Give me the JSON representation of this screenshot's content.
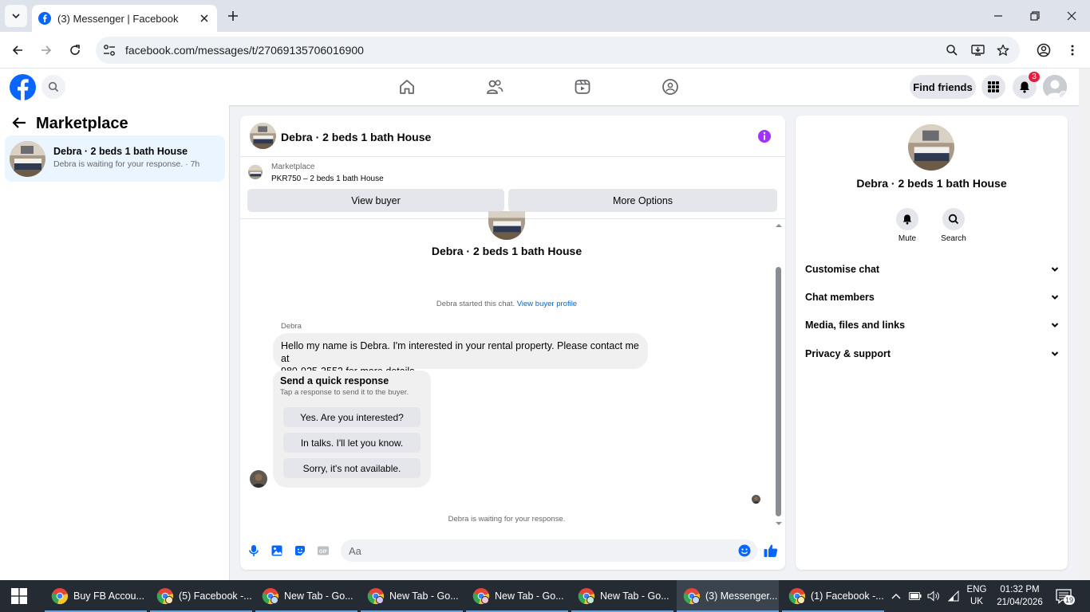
{
  "browser": {
    "tab_title": "(3) Messenger | Facebook",
    "url": "facebook.com/messages/t/27069135706016900"
  },
  "fb_header": {
    "find_friends_label": "Find friends",
    "notification_count": "3"
  },
  "left_panel": {
    "title": "Marketplace",
    "conversations": [
      {
        "name": "Debra · 2 beds 1 bath House",
        "preview": "Debra is waiting for your response. · 7h"
      }
    ]
  },
  "chat": {
    "header_name": "Debra · 2 beds 1 bath House",
    "marketplace_label": "Marketplace",
    "listing": "PKR750 – 2 beds 1 bath House",
    "view_buyer_label": "View buyer",
    "more_options_label": "More Options",
    "hero_name": "Debra · 2 beds 1 bath House",
    "started_text": "Debra started this chat.",
    "view_profile_link": "View buyer profile",
    "sender_name": "Debra",
    "message_line1": "Hello my name is Debra. I'm interested in your rental property. Please contact me at",
    "message_line2": "980-925-3552 for more details",
    "quick_title": "Send a quick response",
    "quick_subtitle": "Tap a response to send it to the buyer.",
    "quick_responses": [
      "Yes. Are you interested?",
      "In talks. I'll let you know.",
      "Sorry, it's not available."
    ],
    "waiting_text": "Debra is waiting for your response.",
    "composer_placeholder": "Aa"
  },
  "right_panel": {
    "name": "Debra · 2 beds 1 bath House",
    "mute_label": "Mute",
    "search_label": "Search",
    "sections": [
      "Customise chat",
      "Chat members",
      "Media, files and links",
      "Privacy & support"
    ]
  },
  "taskbar": {
    "items": [
      "Buy FB Accou...",
      "(5) Facebook -...",
      "New Tab - Go...",
      "New Tab - Go...",
      "New Tab - Go...",
      "New Tab - Go...",
      "(3) Messenger...",
      "(1) Facebook -..."
    ],
    "lang_line1": "ENG",
    "lang_line2": "UK",
    "time": "01:32 PM",
    "date": "21/04/2026",
    "notification_count": "19"
  },
  "colors": {
    "fb_blue": "#0866ff",
    "messenger_purple": "#a033ff",
    "notification_red": "#e41e3f",
    "taskbar_bg": "#252b33"
  }
}
